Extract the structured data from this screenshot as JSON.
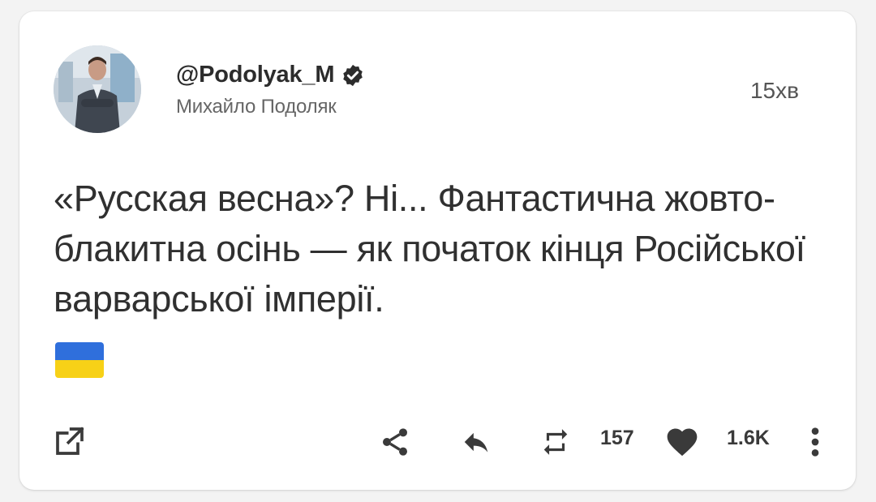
{
  "author": {
    "handle": "@Podolyak_M",
    "display_name": "Михайло Подоляк",
    "verified": true
  },
  "timestamp": "15хв",
  "tweet": {
    "text": "«Русская весна»? Ні... Фантастична жовто-блакитна осінь — як початок кінця Російської варварської імперії.",
    "emoji": "ukraine-flag"
  },
  "actions": {
    "retweets": "157",
    "likes": "1.6K"
  },
  "colors": {
    "card_bg": "#ffffff",
    "page_bg": "#f3f3f3",
    "text": "#303030",
    "icon": "#3a3a3a",
    "flag_blue": "#2f6fdc",
    "flag_yellow": "#f7d117"
  },
  "icons": [
    "external-link-icon",
    "share-icon",
    "reply-icon",
    "retweet-icon",
    "heart-icon",
    "more-vertical-icon",
    "verified-icon"
  ]
}
